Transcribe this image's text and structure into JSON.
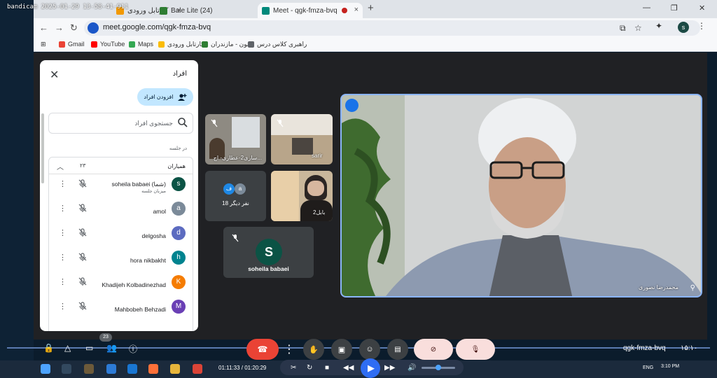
{
  "recorder": {
    "watermark": "bandicam 2025-01-29 13-58-41-911"
  },
  "browser": {
    "tabs": [
      {
        "label": "کارتابل ورودی",
        "color": "#f29900"
      },
      {
        "label": "Bale Lite (24)",
        "color": "#2e7d32"
      },
      {
        "label": "Meet - qgk-fmza-bvq",
        "color": "#00897b",
        "active": true
      }
    ],
    "url": "meet.google.com/qgk-fmza-bvq",
    "profile_initial": "s",
    "bookmarks": [
      {
        "label": "Gmail",
        "color": "#ea4335"
      },
      {
        "label": "YouTube",
        "color": "#ff0000"
      },
      {
        "label": "Maps",
        "color": "#34a853"
      },
      {
        "label": "کارتابل ورودی",
        "color": "#fbbc04"
      },
      {
        "label": "کانون - مازندران",
        "color": "#2e7d32"
      },
      {
        "label": "راهبری کلاس درس",
        "color": "#5f6368"
      }
    ]
  },
  "people_panel": {
    "title": "افراد",
    "add_button": "افزودن افراد",
    "search_placeholder": "جستجوی افراد",
    "section_label": "در جلسه",
    "group_label": "همیاران",
    "group_count": "۲۳",
    "participants": [
      {
        "name": "soheila babaei (شما)",
        "role": "میزبان جلسه",
        "initial": "s",
        "color": "#0b5345"
      },
      {
        "name": "amol",
        "role": "",
        "initial": "a",
        "color": "#7b8a99"
      },
      {
        "name": "delgosha",
        "role": "",
        "initial": "d",
        "color": "#5c6bc0"
      },
      {
        "name": "hora nikbakht",
        "role": "",
        "initial": "h",
        "color": "#00838f"
      },
      {
        "name": "Khadijeh Kolbadinezhad",
        "role": "",
        "initial": "K",
        "color": "#f57c00"
      },
      {
        "name": "Mahbobeh Behzadi",
        "role": "",
        "initial": "M",
        "color": "#6a3fb5"
      }
    ]
  },
  "tiles": {
    "t1_name": "ساری2-عطاری- اح...",
    "t2_name": "sarir",
    "others_label": "18 نفر دیگر",
    "others_initials": [
      "ف",
      "a"
    ],
    "t4_name": "بابل2",
    "self_name": "soheila babaei",
    "self_initial": "S"
  },
  "main_speaker": {
    "name": "محمدرضا نصوری"
  },
  "meet_bar": {
    "code": "qgk-fmza-bvq",
    "clock": "۱۵:۱۰",
    "people_count": "23"
  },
  "player": {
    "time": "01:11:33 / 01:20:29"
  },
  "taskbar": {
    "lang": "ENG",
    "time": "3:10 PM"
  }
}
